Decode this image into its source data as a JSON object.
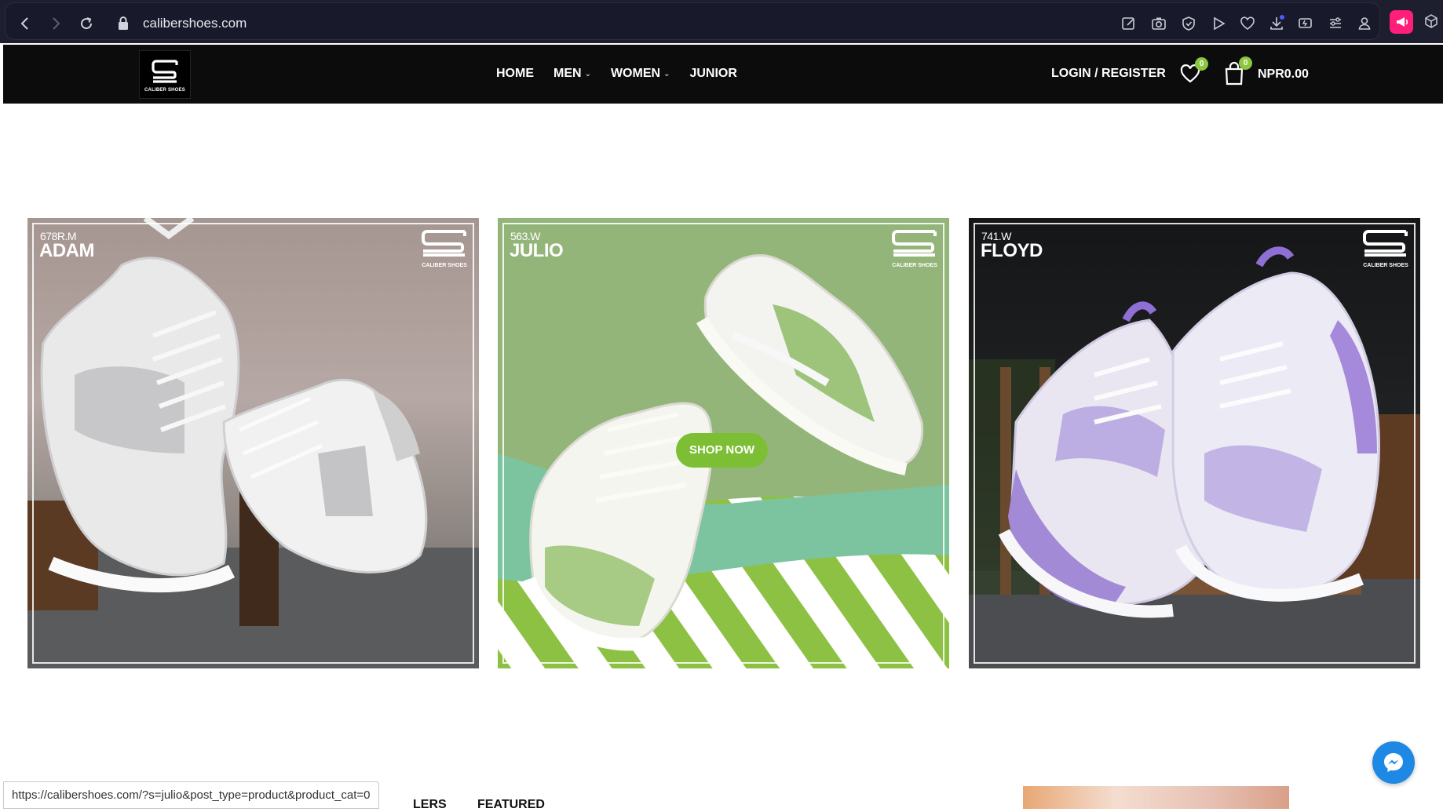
{
  "browser": {
    "url": "calibershoes.com",
    "back_icon": "back-arrow-icon",
    "forward_icon": "forward-arrow-icon",
    "reload_icon": "reload-icon"
  },
  "header": {
    "logo_text": "CALIBER SHOES",
    "nav": [
      {
        "label": "HOME"
      },
      {
        "label": "MEN"
      },
      {
        "label": "WOMEN"
      },
      {
        "label": "JUNIOR"
      }
    ],
    "login_label": "LOGIN / REGISTER",
    "wishlist_count": "0",
    "cart_count": "0",
    "cart_total": "NPR0.00",
    "badge_color": "#8dc63f"
  },
  "banners": [
    {
      "code": "678R.M",
      "name": "ADAM",
      "logo_text": "CALIBER SHOES"
    },
    {
      "code": "563.W",
      "name": "JULIO",
      "logo_text": "CALIBER SHOES",
      "cta": "SHOP NOW"
    },
    {
      "code": "741.W",
      "name": "FLOYD",
      "logo_text": "CALIBER SHOES"
    }
  ],
  "bottom": {
    "status_url": "https://calibershoes.com/?s=julio&post_type=product&product_cat=0",
    "tab_partial": "LERS",
    "tab_featured": "FEATURED"
  },
  "accent_color": "#7cbf35"
}
